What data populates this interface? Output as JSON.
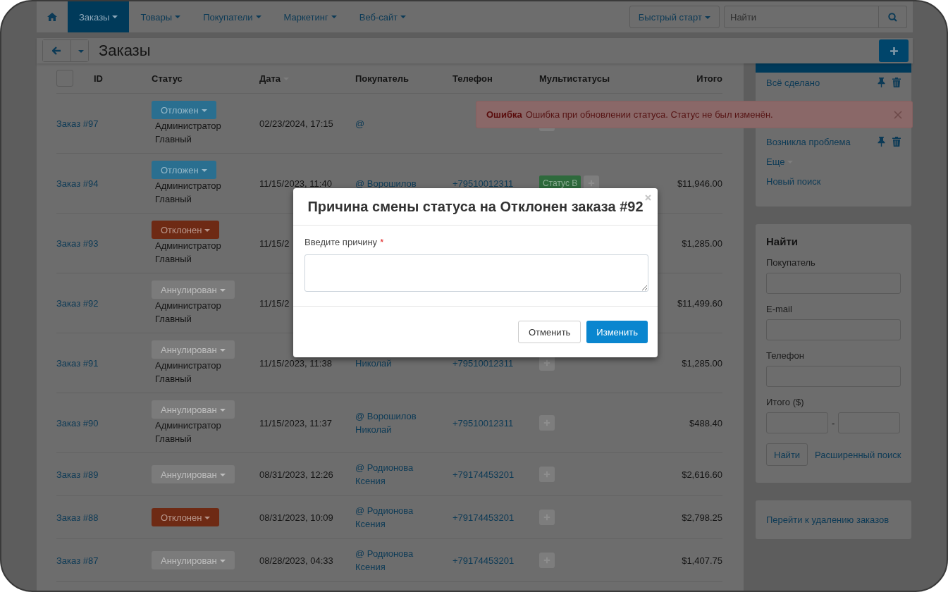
{
  "nav": {
    "items": [
      {
        "label": "Заказы",
        "selected": true
      },
      {
        "label": "Товары",
        "selected": false
      },
      {
        "label": "Покупатели",
        "selected": false
      },
      {
        "label": "Маркетинг",
        "selected": false
      },
      {
        "label": "Веб-сайт",
        "selected": false
      }
    ],
    "quick_start": "Быстрый старт",
    "search": {
      "placeholder": "Найти"
    }
  },
  "header": {
    "title": "Заказы"
  },
  "table": {
    "select_all": {
      "checked": false
    },
    "columns": [
      {
        "label": "ID",
        "sorted": false
      },
      {
        "label": "Статус",
        "sorted": false
      },
      {
        "label": "Дата",
        "sorted": true
      },
      {
        "label": "Покупатель",
        "sorted": false
      },
      {
        "label": "Телефон",
        "sorted": false
      },
      {
        "label": "Мультистатусы",
        "sorted": false
      },
      {
        "label": "Итого",
        "sorted": false
      }
    ],
    "rows": [
      {
        "id": "Заказ #97",
        "status": {
          "label": "Отложен",
          "color": "#2a6f90"
        },
        "author": [
          "Администратор",
          "Главный"
        ],
        "date": "02/23/2024, 17:15",
        "customer": [
          "@"
        ],
        "add_button": true
      },
      {
        "id": "Заказ #94",
        "status": {
          "label": "Отложен",
          "color": "#2a6f90"
        },
        "author": [
          "Администратор",
          "Главный"
        ],
        "date": "11/15/2023, 11:40",
        "customer": [
          "@ Ворошилов"
        ],
        "phone": "+79510012311",
        "multistatus": [
          {
            "label": "Статус В",
            "color": "#2e6a3c"
          }
        ],
        "add_button": true,
        "total": "$11,946.00"
      },
      {
        "id": "Заказ #93",
        "status": {
          "label": "Отклонен",
          "color": "#6e2a14"
        },
        "author": [
          "Администратор",
          "Главный"
        ],
        "date": "11/15/2",
        "total": "$1,285.00"
      },
      {
        "id": "Заказ #92",
        "status": {
          "label": "Аннулирован",
          "color": "#7b7b7b"
        },
        "author": [
          "Администратор",
          "Главный"
        ],
        "date": "11/15/2",
        "total": "$11,499.60"
      },
      {
        "id": "Заказ #91",
        "status": {
          "label": "Аннулирован",
          "color": "#7b7b7b"
        },
        "author": [
          "Администратор",
          "Главный"
        ],
        "date": "11/15/2023, 11:38",
        "customer": [
          "Николай"
        ],
        "phone": "+79510012311",
        "add_button": true,
        "total": "$1,285.00"
      },
      {
        "id": "Заказ #90",
        "status": {
          "label": "Аннулирован",
          "color": "#7b7b7b"
        },
        "author": [
          "Администратор",
          "Главный"
        ],
        "date": "11/15/2023, 11:37",
        "customer": [
          "@ Ворошилов",
          "Николай"
        ],
        "phone": "+79510012311",
        "add_button": true,
        "total": "$488.40"
      },
      {
        "id": "Заказ #89",
        "status": {
          "label": "Аннулирован",
          "color": "#7b7b7b"
        },
        "date": "08/31/2023, 12:26",
        "customer": [
          "@ Родионова",
          "Ксения"
        ],
        "phone": "+79174453201",
        "add_button": true,
        "total": "$2,616.60"
      },
      {
        "id": "Заказ #88",
        "status": {
          "label": "Отклонен",
          "color": "#6e2a14"
        },
        "date": "08/31/2023, 10:09",
        "customer": [
          "@ Родионова",
          "Ксения"
        ],
        "phone": "+79174453201",
        "add_button": true,
        "total": "$2,798.25"
      },
      {
        "id": "Заказ #87",
        "status": {
          "label": "Аннулирован",
          "color": "#7b7b7b"
        },
        "date": "08/28/2023, 04:33",
        "customer": [
          "@ Родионова",
          "Ксения"
        ],
        "phone": "+79174453201",
        "add_button": true,
        "total": "$1,407.75"
      }
    ]
  },
  "saved_searches": {
    "items": [
      {
        "label": "Всё сделано"
      },
      {
        "label": "Возникла проблема"
      }
    ],
    "more": "Еще",
    "new_search": "Новый поиск"
  },
  "search_panel": {
    "title": "Найти",
    "fields": [
      {
        "label": "Покупатель"
      },
      {
        "label": "E-mail"
      },
      {
        "label": "Телефон"
      }
    ],
    "range_label": "Итого ($)",
    "range_separator": "-",
    "button": "Найти",
    "advanced_link": "Расширенный поиск"
  },
  "delete_link": "Перейти к удалению заказов",
  "alert": {
    "title": "Ошибка",
    "message": "Ошибка при обновлении статуса. Статус не был изменён."
  },
  "modal": {
    "title": "Причина смены статуса на Отклонен заказа #92",
    "label": "Введите причину",
    "required_mark": "*",
    "cancel": "Отменить",
    "submit": "Изменить"
  }
}
